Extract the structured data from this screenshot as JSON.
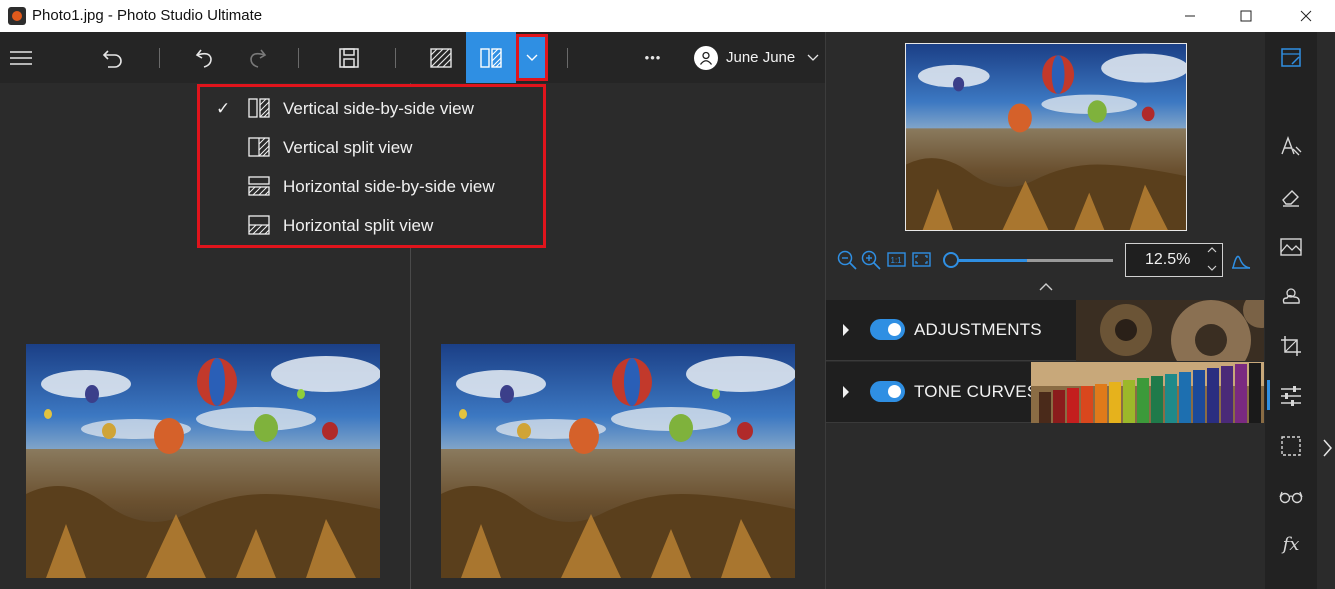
{
  "window": {
    "title": "Photo1.jpg - Photo Studio Ultimate"
  },
  "toolbar": {
    "buttons": [
      "menu-icon",
      "undo-all-icon",
      "undo-icon",
      "redo-icon",
      "save-icon",
      "split-view-icon",
      "side-by-side-icon",
      "chevron-down-icon",
      "more-icon"
    ],
    "more_label": "•••",
    "user_name": "June June"
  },
  "view_menu": {
    "items": [
      {
        "label": "Vertical side-by-side view",
        "checked": true,
        "icon": "vertical-side-by-side-icon"
      },
      {
        "label": "Vertical split view",
        "checked": false,
        "icon": "vertical-split-icon"
      },
      {
        "label": "Horizontal side-by-side view",
        "checked": false,
        "icon": "horizontal-side-by-side-icon"
      },
      {
        "label": "Horizontal split view",
        "checked": false,
        "icon": "horizontal-split-icon"
      }
    ],
    "check_glyph": "✓"
  },
  "zoom": {
    "value": "12.5%",
    "slider_fraction": 0.47,
    "icons": [
      "zoom-out-icon",
      "zoom-in-icon",
      "actual-size-icon",
      "fit-icon",
      "histogram-icon"
    ]
  },
  "panels": [
    {
      "label": "ADJUSTMENTS",
      "enabled": true
    },
    {
      "label": "TONE CURVES",
      "enabled": true
    }
  ],
  "right_toolbar": {
    "icons": [
      "edit-icon",
      "text-effects-icon",
      "eraser-icon",
      "landscape-icon",
      "weather-icon",
      "crop-icon",
      "sliders-icon",
      "selection-icon",
      "glasses-icon",
      "fx-icon"
    ],
    "active": "sliders-icon",
    "fx_label": "fx"
  },
  "colors": {
    "accent": "#2f8fe3",
    "highlight": "#e0141c",
    "background": "#2b2b2b"
  }
}
